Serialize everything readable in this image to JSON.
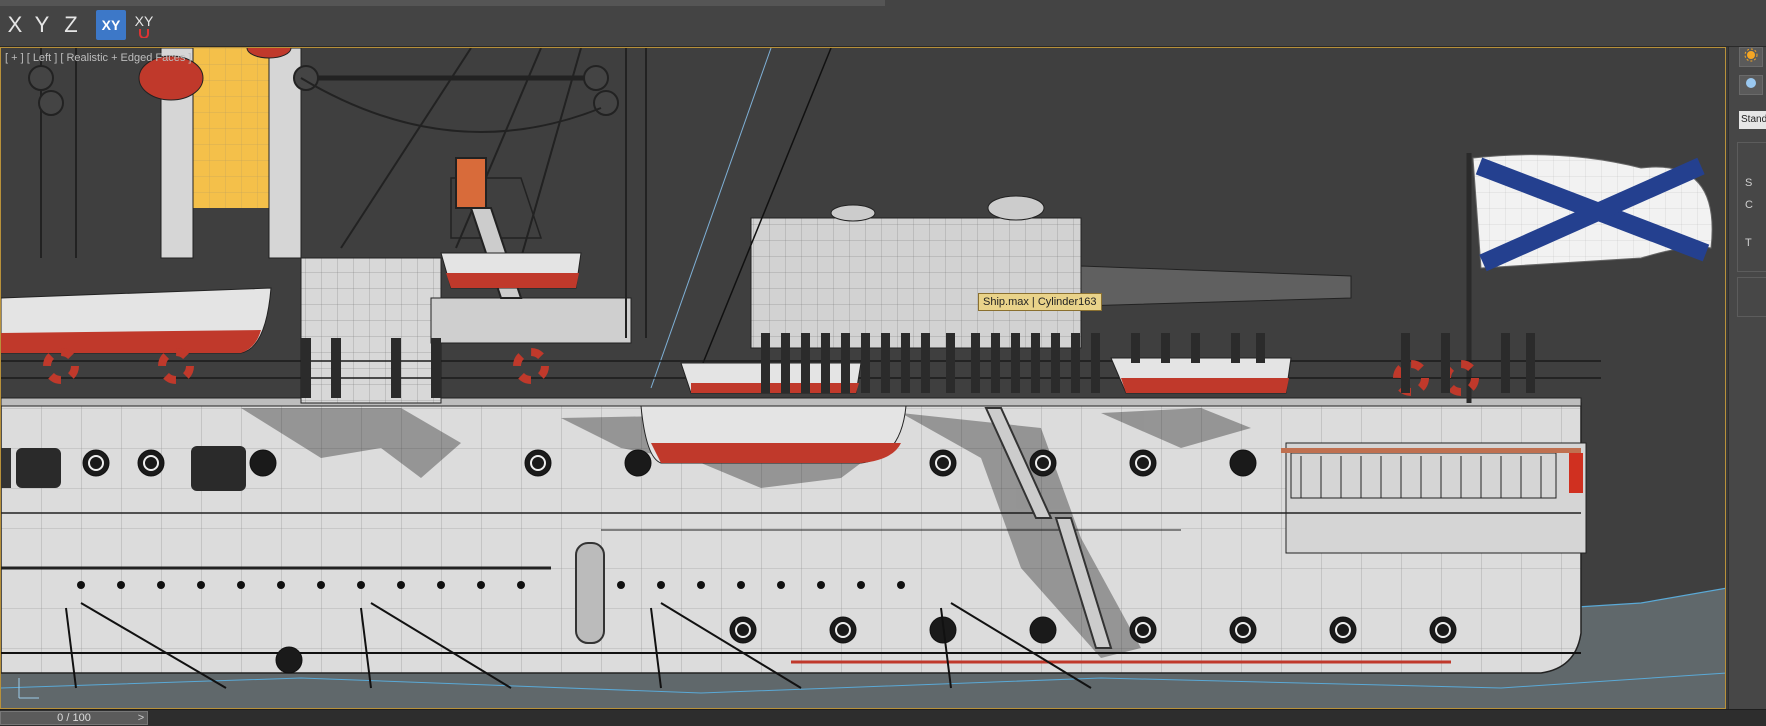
{
  "toolbar": {
    "axis_x": "X",
    "axis_y": "Y",
    "axis_z": "Z",
    "axis_xy": "XY",
    "axis_xy_constraint": "XY"
  },
  "viewport": {
    "label": "[ + ] [ Left ] [ Realistic + Edged Faces ]",
    "tooltip": "Ship.max | Cylinder163",
    "flag_icon": "andreevsky-flag"
  },
  "right_panel": {
    "dropdown_value": "Stand",
    "side_letters": [
      "S",
      "C",
      "T"
    ]
  },
  "timeline": {
    "frame_display": "0 / 100",
    "next_label": ">",
    "current_frame": 0,
    "total_frames": 100
  },
  "colors": {
    "active_axis": "#3d78c8",
    "viewport_border": "#b8913a",
    "hull": "#e0e0e0",
    "hull_red": "#c0392b",
    "water_line": "#5aa9d6"
  }
}
